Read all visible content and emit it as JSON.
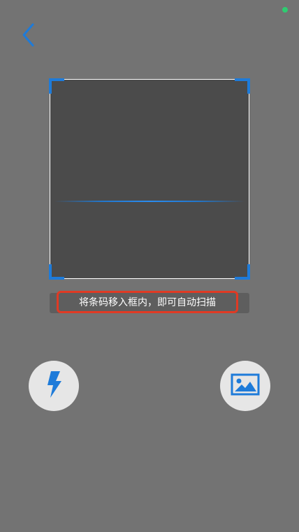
{
  "status_bar": {
    "indicator_color": "#2ecc71"
  },
  "header": {
    "back_icon": "chevron-left-icon"
  },
  "scanner": {
    "accent_color": "#1e7bd9",
    "frame_color": "#ffffff",
    "hint": "将条码移入框内，即可自动扫描"
  },
  "controls": {
    "flash_icon": "lightning-icon",
    "album_icon": "image-gallery-icon"
  }
}
